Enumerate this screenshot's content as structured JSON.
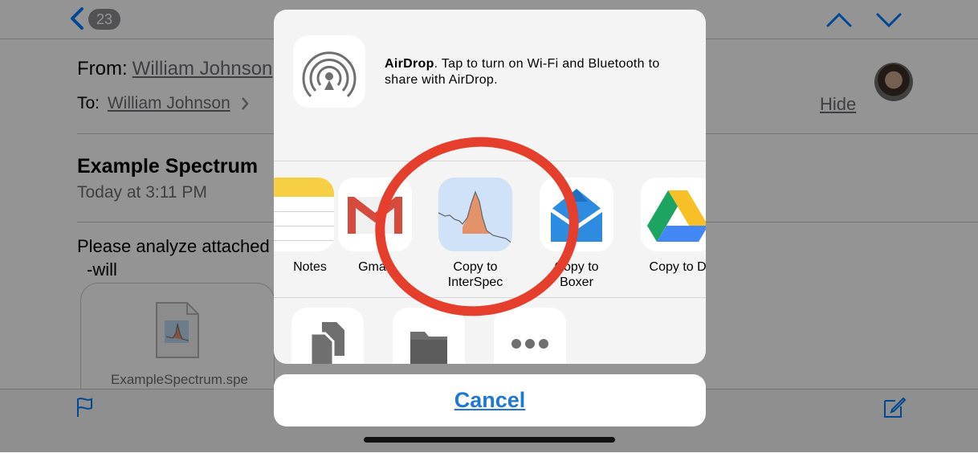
{
  "mail": {
    "unread_count": "23",
    "from_label": "From:",
    "from_name": "William Johnson",
    "to_label": "To:",
    "to_name": "William Johnson",
    "hide_label": "Hide",
    "subject": "Example Spectrum",
    "date": "Today at 3:11 PM",
    "body_line1": "Please analyze attached",
    "body_line2": "-will",
    "attachment_name": "ExampleSpectrum.spe"
  },
  "share_sheet": {
    "airdrop_title": "AirDrop",
    "airdrop_message": ". Tap to turn on Wi-Fi and Bluetooth to share with AirDrop.",
    "apps": [
      {
        "label": "Notes",
        "icon": "notes-icon"
      },
      {
        "label": "Gmail",
        "icon": "gmail-icon"
      },
      {
        "label": "Copy to\nInterSpec",
        "icon": "interspec-icon"
      },
      {
        "label": "Copy to\nBoxer",
        "icon": "boxer-icon"
      },
      {
        "label": "Copy to Drive",
        "icon": "google-drive-icon"
      }
    ],
    "actions": [
      {
        "icon": "copy-icon"
      },
      {
        "icon": "folder-icon"
      },
      {
        "icon": "more-icon"
      }
    ],
    "cancel_label": "Cancel"
  },
  "colors": {
    "highlight": "#e63e2c",
    "link_blue": "#1f77d4",
    "dim_overlay": "rgba(0,0,0,0.42)"
  }
}
